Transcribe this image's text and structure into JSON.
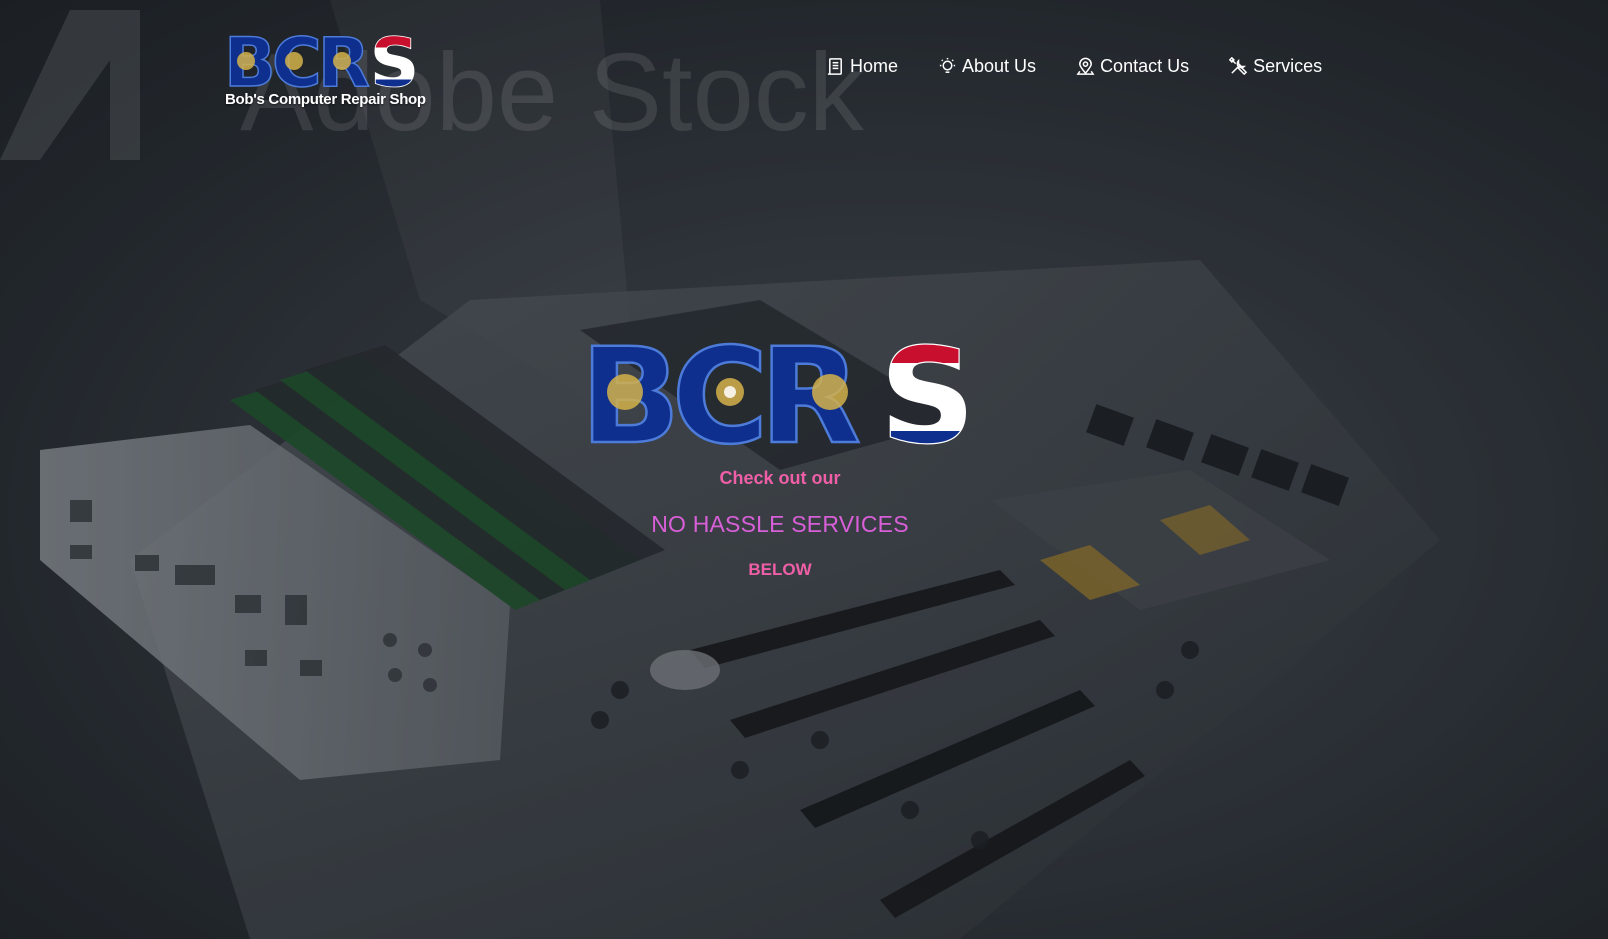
{
  "brand": {
    "logo_text": "BCRS",
    "name": "Bob's Computer Repair Shop",
    "logo_icon": "bcrs-flag-lettering-logo"
  },
  "nav": {
    "items": [
      {
        "label": "Home",
        "icon": "document-icon"
      },
      {
        "label": "About Us",
        "icon": "lightbulb-icon"
      },
      {
        "label": "Contact Us",
        "icon": "map-pin-icon"
      },
      {
        "label": "Services",
        "icon": "tools-icon"
      }
    ]
  },
  "hero": {
    "logo_text": "BCRS",
    "intro": "Check out our",
    "headline": "NO HASSLE SERVICES",
    "outro": "BELOW",
    "watermark": "Adobe Stock"
  },
  "colors": {
    "nav_text": "#ffffff",
    "intro_pink": "#ef5fa7",
    "headline_magenta": "#d85fd8",
    "logo_blue": "#0f2f8f",
    "logo_red": "#c8102e",
    "background": "#2b3138"
  }
}
